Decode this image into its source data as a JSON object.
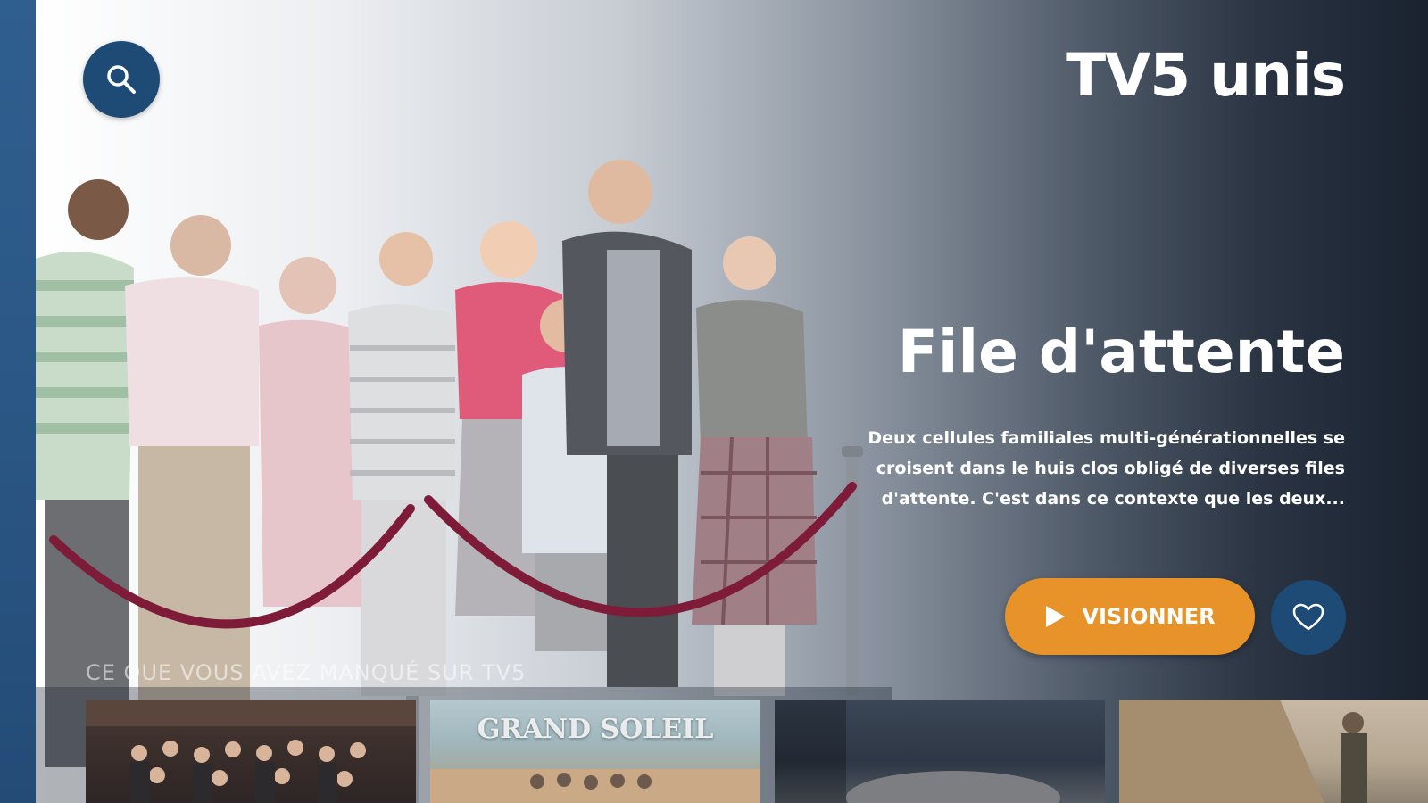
{
  "brand": {
    "logo_text": "TV5 unis",
    "accent_color": "#1e4a76",
    "cta_color": "#e8922a"
  },
  "header": {
    "search_icon": "search-icon"
  },
  "hero": {
    "title": "File d'attente",
    "description": "Deux cellules familiales multi-générationnelles se croisent dans le huis clos obligé de diverses files d'attente. C'est dans ce contexte que les deux...",
    "play_icon": "play-icon",
    "play_label": "VISIONNER",
    "favorite_icon": "heart-icon"
  },
  "row": {
    "label": "CE QUE VOUS AVEZ MANQUÉ SUR TV5",
    "items": [
      {
        "title": ""
      },
      {
        "title": "GRAND SOLEIL"
      },
      {
        "title": ""
      },
      {
        "title": ""
      }
    ]
  }
}
